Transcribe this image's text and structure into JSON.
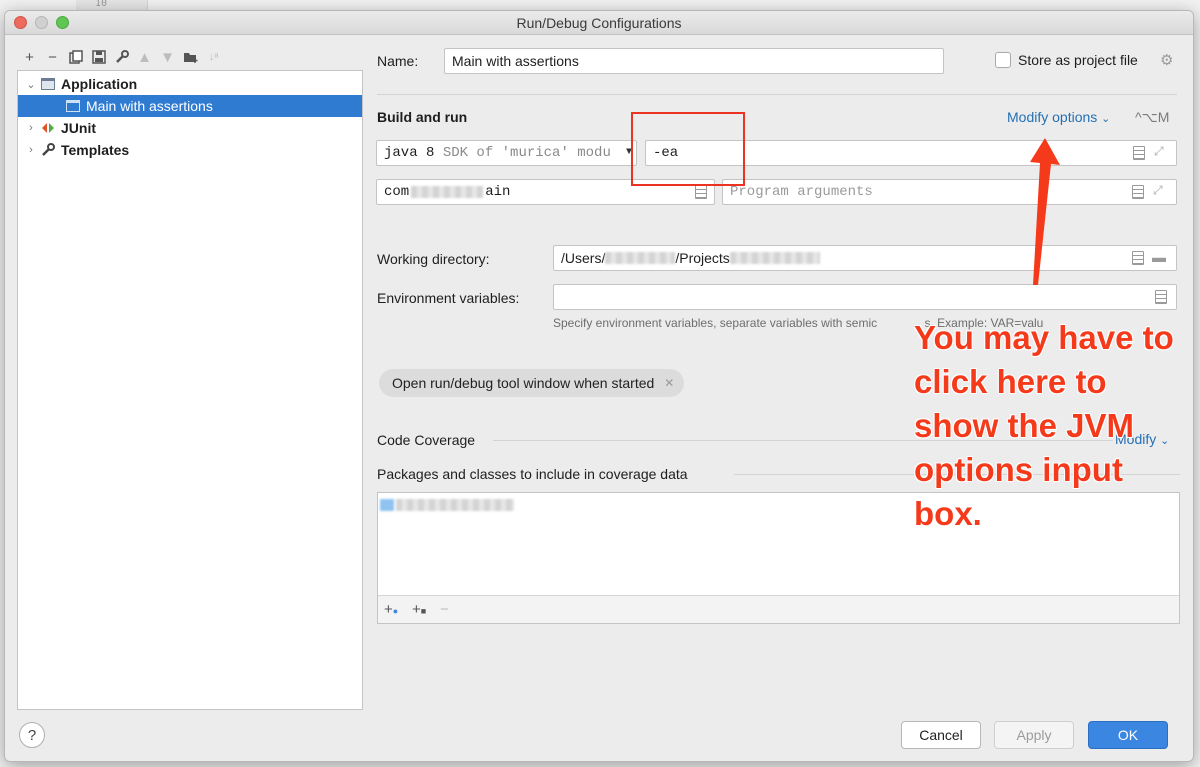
{
  "background": {
    "gutter_line": "10"
  },
  "window": {
    "title": "Run/Debug Configurations"
  },
  "toolbar": {
    "icons": [
      "plus-icon",
      "minus-icon",
      "copy-icon",
      "save-icon",
      "wrench-icon",
      "arrow-up-icon",
      "arrow-down-icon",
      "folder-add-icon",
      "sort-icon"
    ]
  },
  "tree": {
    "application": "Application",
    "main_with_assertions": "Main with assertions",
    "junit": "JUnit",
    "templates": "Templates"
  },
  "form": {
    "name_label": "Name:",
    "name_value": "Main with assertions",
    "store_label": "Store as project file",
    "build_run_title": "Build and run",
    "modify_options": "Modify options",
    "modify_shortcut": "^⌥M",
    "sdk_java": "java 8",
    "sdk_detail": "SDK of 'murica' modu",
    "vm_options": "-ea",
    "main_class_prefix": "com",
    "main_class_suffix": "ain",
    "program_args_placeholder": "Program arguments",
    "working_dir_label": "Working directory:",
    "working_dir_a": "/Users/",
    "working_dir_b": "/Projects",
    "env_label": "Environment variables:",
    "env_hint": "Specify environment variables, separate variables with semic",
    "env_hint_tail": "s. Example: VAR=valu",
    "chip_label": "Open run/debug tool window when started",
    "code_coverage": "Code Coverage",
    "coverage_modify": "Modify",
    "packages_label": "Packages and classes to include in coverage data"
  },
  "buttons": {
    "help": "?",
    "cancel": "Cancel",
    "apply": "Apply",
    "ok": "OK"
  },
  "annotation": {
    "text": "You may have to click here to show the JVM options input box.",
    "color": "#f43a1a"
  }
}
